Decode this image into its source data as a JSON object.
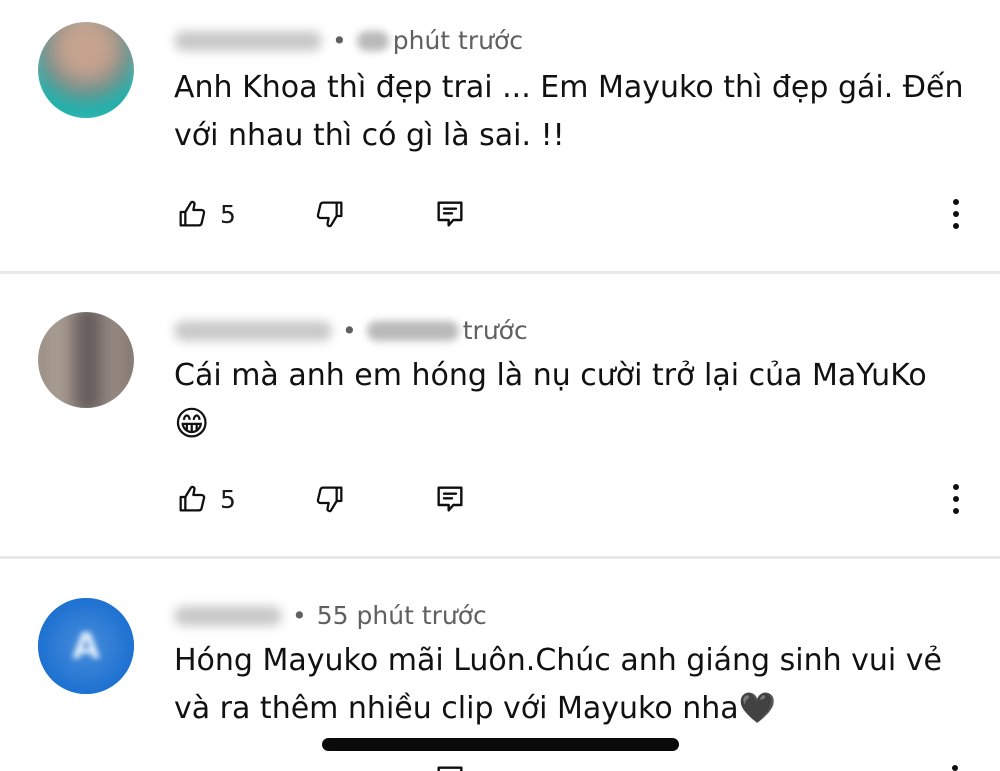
{
  "comments": [
    {
      "time_suffix": "phút trước",
      "text": "Anh Khoa thì đẹp trai ... Em Mayuko thì đẹp gái. Đến với nhau thì có gì là sai. !!",
      "likes": "5",
      "avatar_colors": [
        "#c9a08a",
        "#1fb5b0"
      ]
    },
    {
      "time_suffix": "trước",
      "text": "Cái mà anh em hóng là nụ cười trở lại của MaYuKo",
      "emoji": "😁",
      "likes": "5",
      "avatar_colors": [
        "#9a8e86",
        "#5a5052"
      ]
    },
    {
      "time": "55 phút trước",
      "text": "Hóng Mayuko mãi Luôn.Chúc anh giáng sinh vui vẻ và ra thêm nhiều clip với Mayuko nha",
      "emoji": "🖤",
      "avatar_letter": "A",
      "avatar_colors": [
        "#1a6fd0"
      ]
    }
  ],
  "separator": "•"
}
